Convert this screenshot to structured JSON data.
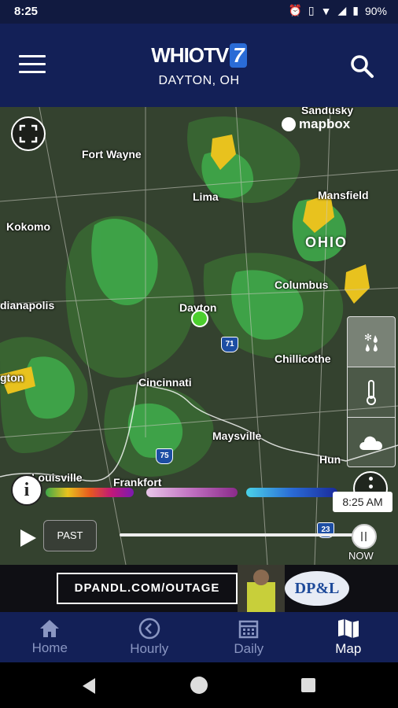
{
  "status": {
    "time": "8:25",
    "battery": "90%"
  },
  "header": {
    "logo_text": "WHIOTV",
    "logo_number": "7",
    "location": "DAYTON, OH"
  },
  "map": {
    "attribution": "mapbox",
    "cities": {
      "sandusky": "Sandusky",
      "fort_wayne": "Fort Wayne",
      "lima": "Lima",
      "mansfield": "Mansfield",
      "kokomo": "Kokomo",
      "columbus": "Columbus",
      "indianapolis": "dianapolis",
      "dayton": "Dayton",
      "chillicothe": "Chillicothe",
      "cincinnati": "Cincinnati",
      "lexington": "gton",
      "maysville": "Maysville",
      "huntington": "Hun",
      "louisville": "Louisville",
      "frankfort": "Frankfort"
    },
    "state_label": "OHIO",
    "highways": {
      "i71": "71",
      "i75": "75",
      "i23": "23"
    }
  },
  "timeline": {
    "timestamp": "8:25 AM",
    "past_label": "PAST",
    "now_label": "NOW",
    "progress": 1.0
  },
  "ad": {
    "text": "DPANDL.COM/OUTAGE",
    "brand": "DP&L"
  },
  "tabs": [
    {
      "label": "Home",
      "icon": "home-icon"
    },
    {
      "label": "Hourly",
      "icon": "clock-icon"
    },
    {
      "label": "Daily",
      "icon": "calendar-icon"
    },
    {
      "label": "Map",
      "icon": "map-icon"
    }
  ],
  "colors": {
    "appbar": "#132057",
    "accent": "#2a6bd6",
    "radar_green": "#3fa84a",
    "radar_yellow": "#e8c21e",
    "current_location": "#4ccf2e"
  }
}
